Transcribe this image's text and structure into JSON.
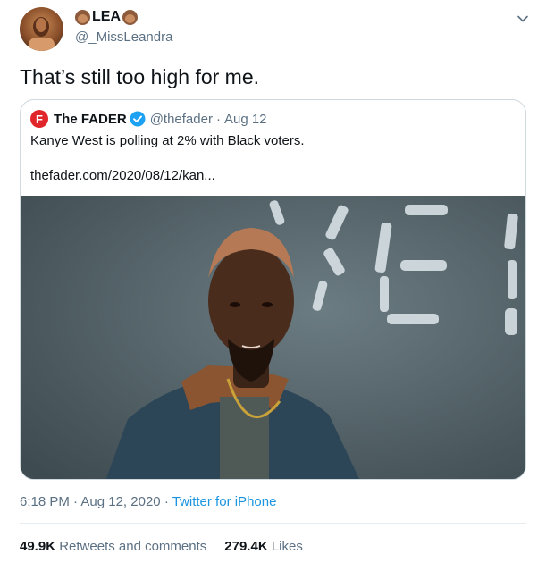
{
  "author": {
    "display_name": "LEA",
    "handle": "@_MissLeandra",
    "name_emoji": "woman-emoji-icon"
  },
  "tweet": {
    "text": "That’s still too high for me."
  },
  "quoted": {
    "name": "The FADER",
    "handle": "@thefader",
    "separator": "·",
    "date": "Aug 12",
    "text": "Kanye West is polling at 2% with Black voters.",
    "link": "thefader.com/2020/08/12/kan..."
  },
  "meta": {
    "time": "6:18 PM",
    "separator": "·",
    "date": "Aug 12, 2020",
    "source": "Twitter for iPhone"
  },
  "stats": {
    "retweets_count": "49.9K",
    "retweets_label": "Retweets and comments",
    "likes_count": "279.4K",
    "likes_label": "Likes"
  },
  "colors": {
    "link_blue": "#1b95e0",
    "fader_red": "#e0262b",
    "muted_text": "#5b7083"
  }
}
